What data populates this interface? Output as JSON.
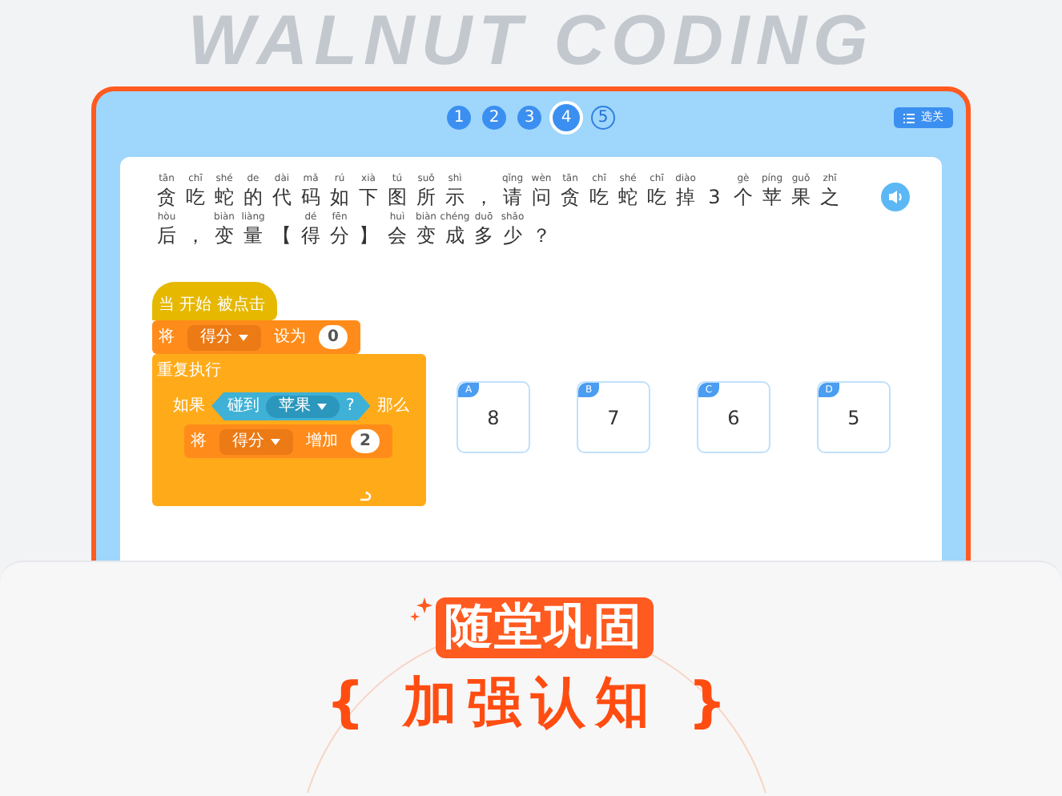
{
  "backdrop_title": "WALNUT CODING",
  "steps": [
    {
      "label": "1",
      "completed": true,
      "selected": false
    },
    {
      "label": "2",
      "completed": true,
      "selected": false
    },
    {
      "label": "3",
      "completed": true,
      "selected": false
    },
    {
      "label": "4",
      "completed": true,
      "selected": true
    },
    {
      "label": "5",
      "completed": false,
      "selected": false
    }
  ],
  "level_button": "选关",
  "question": {
    "lines": [
      [
        {
          "char": "贪",
          "pinyin": "tān"
        },
        {
          "char": "吃",
          "pinyin": "chī"
        },
        {
          "char": "蛇",
          "pinyin": "shé"
        },
        {
          "char": "的",
          "pinyin": "de"
        },
        {
          "char": "代",
          "pinyin": "dài"
        },
        {
          "char": "码",
          "pinyin": "mǎ"
        },
        {
          "char": "如",
          "pinyin": "rú"
        },
        {
          "char": "下",
          "pinyin": "xià"
        },
        {
          "char": "图",
          "pinyin": "tú"
        },
        {
          "char": "所",
          "pinyin": "suǒ"
        },
        {
          "char": "示",
          "pinyin": "shì"
        },
        {
          "char": "，"
        },
        {
          "char": "请",
          "pinyin": "qǐng"
        },
        {
          "char": "问",
          "pinyin": "wèn"
        },
        {
          "char": "贪",
          "pinyin": "tān"
        },
        {
          "char": "吃",
          "pinyin": "chī"
        },
        {
          "char": "蛇",
          "pinyin": "shé"
        },
        {
          "char": "吃",
          "pinyin": "chī"
        },
        {
          "char": "掉",
          "pinyin": "diào"
        },
        {
          "char": "3"
        },
        {
          "char": "个",
          "pinyin": "gè"
        },
        {
          "char": "苹",
          "pinyin": "píng"
        },
        {
          "char": "果",
          "pinyin": "guǒ"
        },
        {
          "char": "之",
          "pinyin": "zhī"
        }
      ],
      [
        {
          "char": "后",
          "pinyin": "hòu"
        },
        {
          "char": "，"
        },
        {
          "char": "变",
          "pinyin": "biàn"
        },
        {
          "char": "量",
          "pinyin": "liàng"
        },
        {
          "char": "【"
        },
        {
          "char": "得",
          "pinyin": "dé"
        },
        {
          "char": "分",
          "pinyin": "fēn"
        },
        {
          "char": "】"
        },
        {
          "char": "会",
          "pinyin": "huì"
        },
        {
          "char": "变",
          "pinyin": "biàn"
        },
        {
          "char": "成",
          "pinyin": "chéng"
        },
        {
          "char": "多",
          "pinyin": "duō"
        },
        {
          "char": "少",
          "pinyin": "shǎo"
        },
        {
          "char": "？"
        }
      ]
    ]
  },
  "code_blocks": [
    {
      "kind": "hat",
      "parts": [
        {
          "kind": "label",
          "text": "当 开始 被点击"
        }
      ]
    },
    {
      "kind": "stack",
      "parts": [
        {
          "kind": "label",
          "text": "将"
        },
        {
          "kind": "dropdown",
          "text": "得分"
        },
        {
          "kind": "label",
          "text": "设为"
        },
        {
          "kind": "number",
          "text": "0"
        }
      ]
    },
    {
      "kind": "repeat",
      "parts": [
        {
          "kind": "label",
          "text": "重复执行"
        }
      ],
      "children": [
        {
          "kind": "if",
          "parts": [
            {
              "kind": "label",
              "text": "如果"
            },
            {
              "kind": "boolean",
              "parts": [
                {
                  "kind": "label",
                  "text": "碰到"
                },
                {
                  "kind": "dropdown",
                  "text": "苹果"
                },
                {
                  "kind": "label",
                  "text": "?"
                }
              ]
            },
            {
              "kind": "label",
              "text": "那么"
            }
          ],
          "children": [
            {
              "kind": "stack",
              "parts": [
                {
                  "kind": "label",
                  "text": "将"
                },
                {
                  "kind": "dropdown",
                  "text": "得分"
                },
                {
                  "kind": "label",
                  "text": "增加"
                },
                {
                  "kind": "number",
                  "text": "2"
                }
              ]
            }
          ]
        }
      ]
    }
  ],
  "options": [
    {
      "letter": "A",
      "value": "8"
    },
    {
      "letter": "B",
      "value": "7"
    },
    {
      "letter": "C",
      "value": "6"
    },
    {
      "letter": "D",
      "value": "5"
    }
  ],
  "banner": {
    "title": "随堂巩固",
    "subtitle": "{ 加强认知 }"
  }
}
